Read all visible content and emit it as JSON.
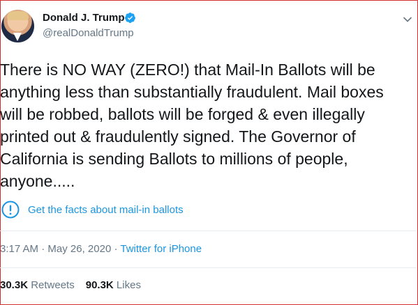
{
  "user": {
    "display_name": "Donald J. Trump",
    "handle": "@realDonaldTrump",
    "verified_icon": "verified-badge-icon",
    "avatar": "profile-photo"
  },
  "menu": {
    "icon": "chevron-down-icon"
  },
  "tweet": {
    "text": "There is NO WAY (ZERO!) that Mail-In Ballots will be\nanything less than substantially fraudulent. Mail boxes\nwill be robbed, ballots will be forged & even illegally\nprinted out & fraudulently signed. The Governor of\nCalifornia is sending Ballots to millions of people,\nanyone....."
  },
  "fact_check": {
    "icon": "exclamation-circle-icon",
    "label": "Get the facts about mail-in ballots"
  },
  "meta": {
    "time": "3:17 AM",
    "sep1": " · ",
    "date": "May 26, 2020",
    "sep2": " · ",
    "source": "Twitter for iPhone"
  },
  "stats": {
    "retweets_count": "30.3K",
    "retweets_label": " Retweets",
    "likes_count": "90.3K",
    "likes_label": " Likes"
  },
  "colors": {
    "accent": "#1b95e0",
    "text": "#14171a",
    "muted": "#657786",
    "frame": "#d32f2f"
  }
}
